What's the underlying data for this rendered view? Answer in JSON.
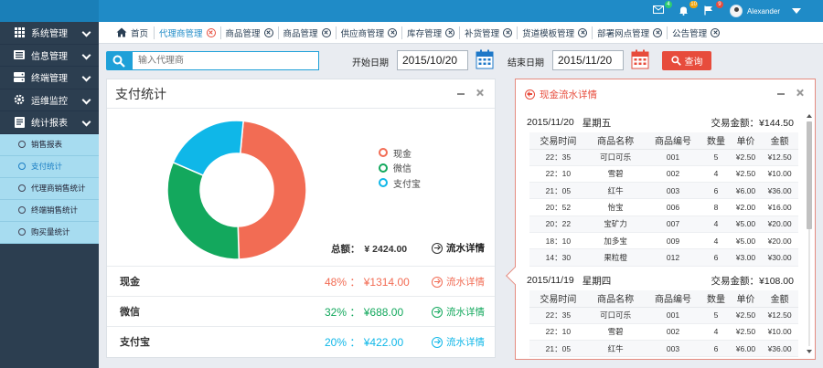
{
  "topbar": {
    "icons": [
      {
        "name": "mail-icon",
        "badge": "4",
        "badge_color": "#2ecc71"
      },
      {
        "name": "bell-icon",
        "badge": "10",
        "badge_color": "#f1a50a"
      },
      {
        "name": "flag-icon",
        "badge": "9",
        "badge_color": "#e74c3c"
      }
    ],
    "user_name": "Alexander"
  },
  "sidebar": {
    "items": [
      {
        "label": "系统管理",
        "icon": "grid-icon"
      },
      {
        "label": "信息管理",
        "icon": "list-icon"
      },
      {
        "label": "终端管理",
        "icon": "server-icon"
      },
      {
        "label": "运维监控",
        "icon": "gear-icon"
      },
      {
        "label": "统计报表",
        "icon": "report-icon"
      }
    ],
    "submenu": [
      {
        "label": "销售报表",
        "active": false
      },
      {
        "label": "支付统计",
        "active": true
      },
      {
        "label": "代理商销售统计",
        "active": false
      },
      {
        "label": "终端销售统计",
        "active": false
      },
      {
        "label": "购买量统计",
        "active": false
      }
    ]
  },
  "tabs": {
    "home": "首页",
    "items": [
      {
        "label": "代理商管理",
        "active": true
      },
      {
        "label": "商品管理",
        "active": false
      },
      {
        "label": "商品管理",
        "active": false
      },
      {
        "label": "供应商管理",
        "active": false
      },
      {
        "label": "库存管理",
        "active": false
      },
      {
        "label": "补货管理",
        "active": false
      },
      {
        "label": "货道模板管理",
        "active": false
      },
      {
        "label": "部署网点管理",
        "active": false
      },
      {
        "label": "公告管理",
        "active": false
      }
    ]
  },
  "search": {
    "placeholder": "输入代理商",
    "start_label": "开始日期",
    "start_value": "2015/10/20",
    "end_label": "结束日期",
    "end_value": "2015/11/20",
    "query_label": "查询"
  },
  "payment": {
    "title": "支付统计",
    "legend": [
      {
        "label": "现金",
        "color": "#f26c54"
      },
      {
        "label": "微信",
        "color": "#13a85d"
      },
      {
        "label": "支付宝",
        "color": "#0fb7e8"
      }
    ],
    "total_label": "总额：",
    "total_value": "¥ 2424.00",
    "detail_label": "流水详情",
    "rows": [
      {
        "name": "现金",
        "pct": "48%",
        "sep": "：",
        "amount": "¥1314.00",
        "color": "#f26c54",
        "detail": "流水详情"
      },
      {
        "name": "微信",
        "pct": "32%",
        "sep": "：",
        "amount": "¥688.00",
        "color": "#13a85d",
        "detail": "流水详情"
      },
      {
        "name": "支付宝",
        "pct": "20%",
        "sep": "：",
        "amount": "¥422.00",
        "color": "#0fb7e8",
        "detail": "流水详情"
      }
    ]
  },
  "chart_data": {
    "type": "pie",
    "donut": true,
    "categories": [
      "现金",
      "微信",
      "支付宝"
    ],
    "values": [
      48,
      32,
      20
    ],
    "colors": [
      "#f26c54",
      "#13a85d",
      "#0fb7e8"
    ]
  },
  "flow": {
    "title": "现金流水详情",
    "columns": [
      "交易时间",
      "商品名称",
      "商品编号",
      "数量",
      "单价",
      "金额"
    ],
    "days": [
      {
        "date": "2015/11/20",
        "weekday": "星期五",
        "amount_label": "交易金额：¥144.50",
        "rows": [
          [
            "22：35",
            "可口可乐",
            "001",
            "5",
            "¥2.50",
            "¥12.50"
          ],
          [
            "22：10",
            "雪碧",
            "002",
            "4",
            "¥2.50",
            "¥10.00"
          ],
          [
            "21：05",
            "红牛",
            "003",
            "6",
            "¥6.00",
            "¥36.00"
          ],
          [
            "20：52",
            "怡宝",
            "006",
            "8",
            "¥2.00",
            "¥16.00"
          ],
          [
            "20：22",
            "宝矿力",
            "007",
            "4",
            "¥5.00",
            "¥20.00"
          ],
          [
            "18：10",
            "加多宝",
            "009",
            "4",
            "¥5.00",
            "¥20.00"
          ],
          [
            "14：30",
            "果粒橙",
            "012",
            "6",
            "¥3.00",
            "¥30.00"
          ]
        ]
      },
      {
        "date": "2015/11/19",
        "weekday": "星期四",
        "amount_label": "交易金额：¥108.00",
        "rows": [
          [
            "22：35",
            "可口可乐",
            "001",
            "5",
            "¥2.50",
            "¥12.50"
          ],
          [
            "22：10",
            "雪碧",
            "002",
            "4",
            "¥2.50",
            "¥10.00"
          ],
          [
            "21：05",
            "红牛",
            "003",
            "6",
            "¥6.00",
            "¥36.00"
          ]
        ]
      }
    ]
  }
}
